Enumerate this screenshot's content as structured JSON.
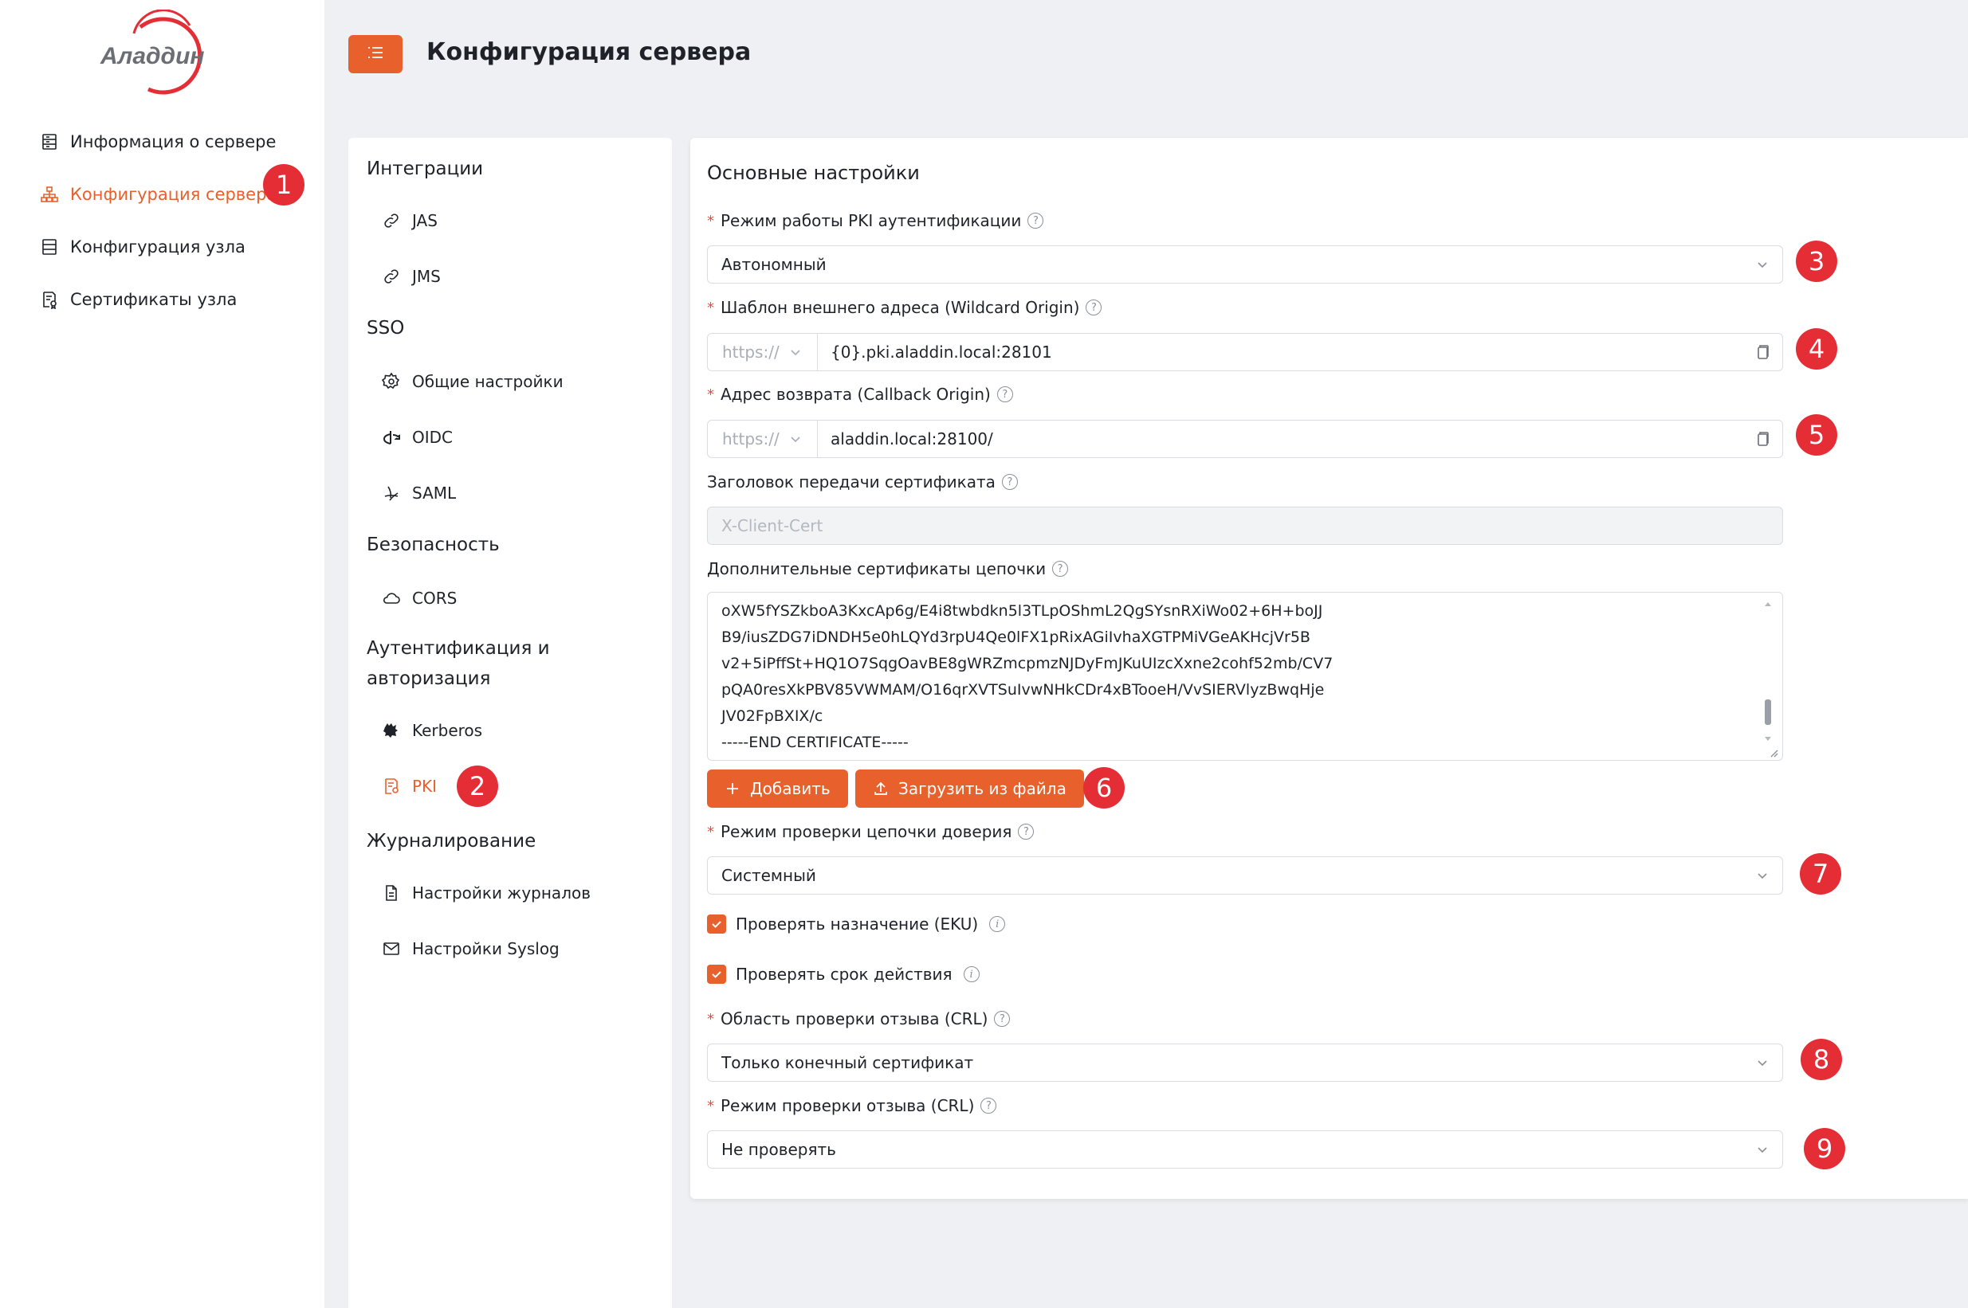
{
  "app": {
    "logo_text": "Аладдин",
    "title": "Конфигурация сервера"
  },
  "colors": {
    "accent": "#e8602c",
    "badge": "#e52d36",
    "background": "#eef0f3"
  },
  "sidebar": {
    "items": [
      {
        "label": "Информация о сервере",
        "icon": "server-info-icon"
      },
      {
        "label": "Конфигурация сервера",
        "icon": "sitemap-icon",
        "active": true
      },
      {
        "label": "Конфигурация узла",
        "icon": "node-config-icon"
      },
      {
        "label": "Сертификаты узла",
        "icon": "certificate-icon"
      }
    ]
  },
  "subnav": {
    "groups": [
      {
        "label": "Интеграции"
      },
      {
        "label": "SSO"
      },
      {
        "label": "Безопасность"
      },
      {
        "label": "Аутентификация и авторизация"
      },
      {
        "label": "Журналирование"
      }
    ],
    "items": {
      "jas": "JAS",
      "jms": "JMS",
      "general": "Общие настройки",
      "oidc": "OIDC",
      "saml": "SAML",
      "cors": "CORS",
      "kerberos": "Kerberos",
      "pki": "PKI",
      "log_settings": "Настройки журналов",
      "syslog": "Настройки Syslog"
    }
  },
  "form": {
    "section_title": "Основные настройки",
    "pki_mode": {
      "label": "Режим работы PKI аутентификации",
      "value": "Автономный"
    },
    "wildcard_origin": {
      "label": "Шаблон внешнего адреса (Wildcard Origin)",
      "scheme": "https://",
      "value": "{0}.pki.aladdin.local:28101"
    },
    "callback_origin": {
      "label": "Адрес возврата (Callback Origin)",
      "scheme": "https://",
      "value": "aladdin.local:28100/"
    },
    "cert_header": {
      "label": "Заголовок передачи сертификата",
      "placeholder": "X-Client-Cert"
    },
    "chain_certs": {
      "label": "Дополнительные сертификаты цепочки",
      "lines": [
        "oXW5fYSZkboA3KxcAp6g/E4i8twbdkn5l3TLpOShmL2QgSYsnRXiWo02+6H+boJJ",
        "B9/iusZDG7iDNDH5e0hLQYd3rpU4Qe0lFX1pRixAGiIvhaXGTPMiVGeAKHcjVr5B",
        "v2+5iPffSt+HQ1O7SqgOavBE8gWRZmcpmzNJDyFmJKuUIzcXxne2cohf52mb/CV7",
        "pQA0resXkPBV85VWMAM/O16qrXVTSuIvwNHkCDr4xBTooeH/VvSIERVlyzBwqHje",
        "JV02FpBXIX/c",
        "-----END CERTIFICATE-----"
      ]
    },
    "add_button": "Добавить",
    "upload_button": "Загрузить из файла",
    "trust_chain_mode": {
      "label": "Режим проверки цепочки доверия",
      "value": "Системный"
    },
    "check_eku": {
      "label": "Проверять назначение (EKU)",
      "checked": true
    },
    "check_validity": {
      "label": "Проверять срок действия",
      "checked": true
    },
    "crl_scope": {
      "label": "Область проверки отзыва (CRL)",
      "value": "Только конечный сертификат"
    },
    "crl_mode": {
      "label": "Режим проверки отзыва (CRL)",
      "value": "Не проверять"
    }
  },
  "badges": [
    "1",
    "2",
    "3",
    "4",
    "5",
    "6",
    "7",
    "8",
    "9"
  ]
}
